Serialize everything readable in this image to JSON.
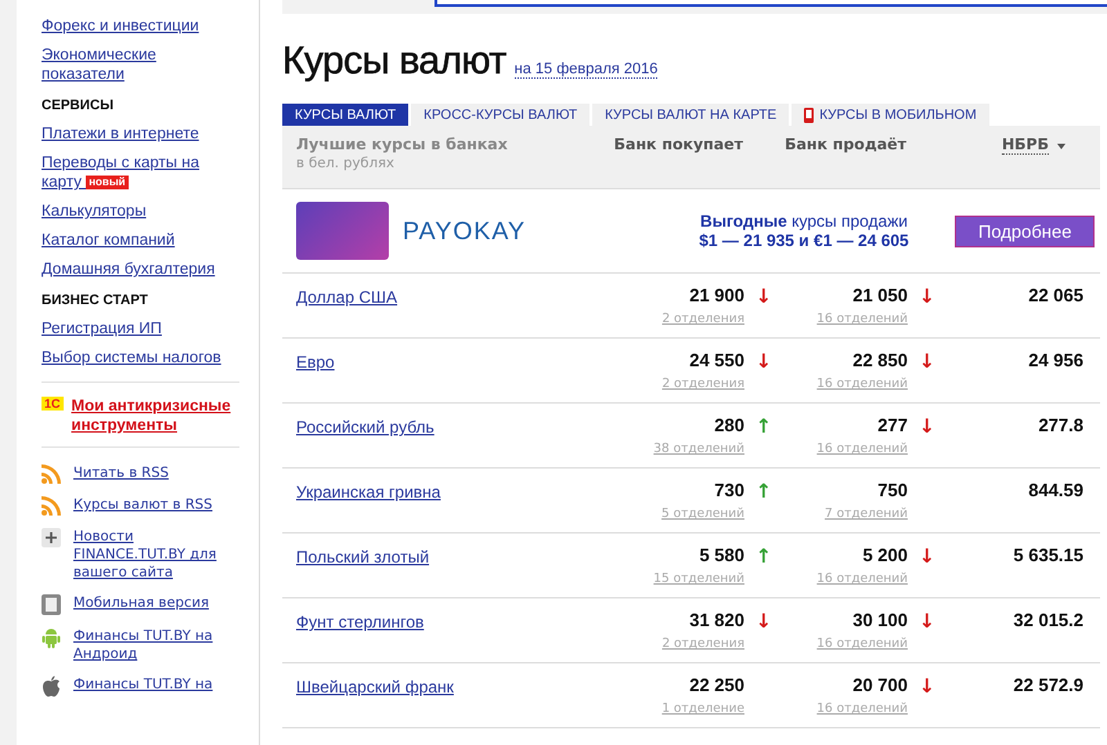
{
  "sidebar": {
    "items": [
      {
        "kind": "link",
        "label": "Форекс и инвестиции"
      },
      {
        "kind": "link",
        "label": "Экономические показатели"
      },
      {
        "kind": "heading",
        "label": "СЕРВИСЫ"
      },
      {
        "kind": "link",
        "label": "Платежи в интернете"
      },
      {
        "kind": "link",
        "label": "Переводы с карты на карту",
        "badge": "новый"
      },
      {
        "kind": "link",
        "label": "Калькуляторы"
      },
      {
        "kind": "link",
        "label": "Каталог компаний"
      },
      {
        "kind": "link",
        "label": "Домашняя бухгалтерия"
      },
      {
        "kind": "heading",
        "label": "БИЗНЕС СТАРТ"
      },
      {
        "kind": "link",
        "label": "Регистрация ИП"
      },
      {
        "kind": "link",
        "label": "Выбор системы налогов"
      }
    ],
    "promo": {
      "logo": "1С",
      "label": "Мои антикризисные инструменты"
    },
    "tools": [
      {
        "kind": "rss",
        "label": "Читать в RSS"
      },
      {
        "kind": "rss",
        "label": "Курсы валют в RSS"
      },
      {
        "kind": "plus",
        "label": "Новости FINANCE.TUT.BY для вашего сайта"
      },
      {
        "kind": "mobile",
        "label": "Мобильная версия"
      },
      {
        "kind": "android",
        "label": "Финансы TUT.BY на Андроид"
      },
      {
        "kind": "apple",
        "label": "Финансы TUT.BY на"
      }
    ]
  },
  "title": "Курсы валют",
  "date": "на 15 февраля 2016",
  "tabs": [
    {
      "label": "КУРСЫ ВАЛЮТ",
      "selected": true
    },
    {
      "label": "КРОСС-КУРСЫ ВАЛЮТ",
      "selected": false
    },
    {
      "label": "КУРСЫ ВАЛЮТ НА КАРТЕ",
      "selected": false
    },
    {
      "label": "КУРСЫ В МОБИЛЬНОМ",
      "selected": false,
      "kind": "mobile"
    }
  ],
  "table": {
    "header": {
      "title": "Лучшие курсы в банках",
      "subtitle": "в бел. рублях",
      "buy": "Банк покупает",
      "sell": "Банк продаёт",
      "nbrb": "НБРБ"
    },
    "ad": {
      "logo": "PAYOKAY",
      "highlight": "Выгодные",
      "text": "курсы продажи",
      "rates": "$1 — 21 935 и €1 — 24 605",
      "button": "Подробнее"
    },
    "rows": [
      {
        "name": "Доллар США",
        "buy": "21 900",
        "buy_arrow": "↓",
        "buy_rising": false,
        "buy_branches": "2 отделения",
        "sell": "21 050",
        "sell_arrow": "↓",
        "sell_rising": false,
        "sell_branches": "16 отделений",
        "nbrb": "22 065"
      },
      {
        "name": "Евро",
        "buy": "24 550",
        "buy_arrow": "↓",
        "buy_rising": false,
        "buy_branches": "2 отделения",
        "sell": "22 850",
        "sell_arrow": "↓",
        "sell_rising": false,
        "sell_branches": "16 отделений",
        "nbrb": "24 956"
      },
      {
        "name": "Российский рубль",
        "buy": "280",
        "buy_arrow": "↑",
        "buy_rising": true,
        "buy_branches": "38 отделений",
        "sell": "277",
        "sell_arrow": "↓",
        "sell_rising": false,
        "sell_branches": "16 отделений",
        "nbrb": "277.8"
      },
      {
        "name": "Украинская гривна",
        "buy": "730",
        "buy_arrow": "↑",
        "buy_rising": true,
        "buy_branches": "5 отделений",
        "sell": "750",
        "sell_branches": "7 отделений",
        "nbrb": "844.59"
      },
      {
        "name": "Польский злотый",
        "buy": "5 580",
        "buy_arrow": "↑",
        "buy_rising": true,
        "buy_branches": "15 отделений",
        "sell": "5 200",
        "sell_arrow": "↓",
        "sell_rising": false,
        "sell_branches": "16 отделений",
        "nbrb": "5 635.15"
      },
      {
        "name": "Фунт стерлингов",
        "buy": "31 820",
        "buy_arrow": "↓",
        "buy_rising": false,
        "buy_branches": "2 отделения",
        "sell": "30 100",
        "sell_arrow": "↓",
        "sell_rising": false,
        "sell_branches": "16 отделений",
        "nbrb": "32 015.2"
      },
      {
        "name": "Швейцарский франк",
        "buy": "22 250",
        "buy_branches": "1 отделение",
        "sell": "20 700",
        "sell_arrow": "↓",
        "sell_rising": false,
        "sell_branches": "16 отделений",
        "nbrb": "22 572.9"
      }
    ]
  }
}
